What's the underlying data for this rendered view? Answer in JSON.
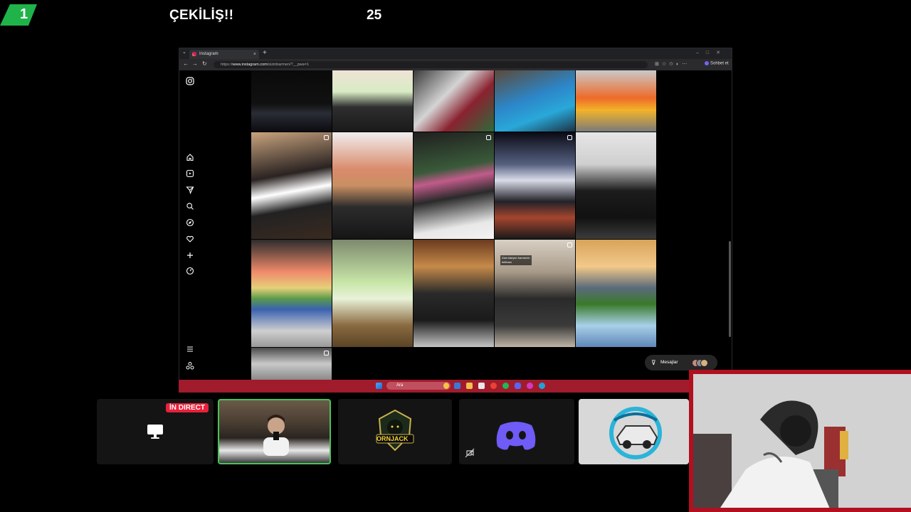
{
  "overlay": {
    "badge_number": "1",
    "title": "ÇEKİLİŞ!!",
    "count": "25"
  },
  "browser": {
    "tab_title": "Instagram",
    "tab_close": "×",
    "new_tab": "+",
    "url_scheme": "https://",
    "url_host": "www.instagram.com",
    "url_path": "/sizinbarmen/?__pwa=1",
    "chat_label": "Sohbet et"
  },
  "instagram": {
    "messages_label": "Mesajlar",
    "sidebar_icons": [
      "home-icon",
      "reels-icon",
      "direct-icon",
      "search-icon",
      "explore-icon",
      "heart-icon",
      "create-icon",
      "profile-icon"
    ]
  },
  "grid_post_caption": "Zam isteyen barmenin imtihanı",
  "taskbar": {
    "search_placeholder": "Ara"
  },
  "participants": {
    "live_badge": "İN DIRECT",
    "tile3_name": "ORNJACK"
  },
  "colors": {
    "accent_green": "#1fb34a",
    "taskbar_red": "#a01c2c",
    "live_red": "#e8203a",
    "active_border": "#47c45a"
  }
}
